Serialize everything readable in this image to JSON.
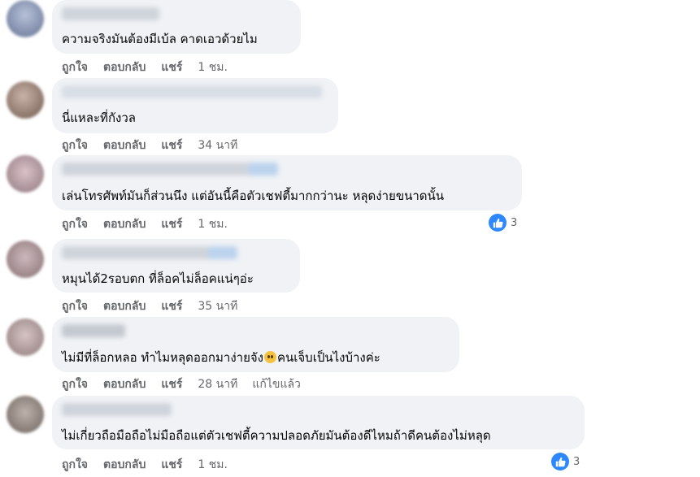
{
  "actions": {
    "like": "ถูกใจ",
    "reply": "ตอบกลับ",
    "share": "แชร์"
  },
  "comments": [
    {
      "text": "ความจริงมันต้องมีเบ้ล คาดเอวด้วยไม",
      "time": "1 ชม."
    },
    {
      "text": "นี่แหละที่กังวล",
      "time": "34 นาที"
    },
    {
      "text": "เล่นโทรศัพท์มันก็ส่วนนึง แต่อันนี้คือตัวเชฟตี้มากกว่านะ หลุดง่ายขนาดนั้น",
      "time": "1 ชม.",
      "reactions": "3"
    },
    {
      "text": "หมุนได้2รอบตก ที่ล็อคไม่ล็อคแน่ๆอ่ะ",
      "time": "35 นาที"
    },
    {
      "text_before": "ไม่มีที่ล็อกหลอ ทำไมหลุดออกมาง่ายจัง",
      "text_after": "คนเจ็บเป็นไงบ้างค่ะ",
      "emoji": "sad-face-emoji",
      "time": "28 นาที",
      "edited": "แก้ไขแล้ว"
    },
    {
      "text": "ไม่เกี่ยวถือมือถือไม่มือถือแต่ตัวเชฟตี้ความปลอดภัยมันต้องดีไหมถ้าดีคนต้องไม่หลุด",
      "time": "1 ชม.",
      "reactions": "3"
    }
  ],
  "colors": {
    "bubble": "#f0f2f5",
    "meta": "#65676b",
    "text": "#050505",
    "like": "#2d88ff"
  },
  "icons": {
    "like": "thumbs-up-icon"
  }
}
